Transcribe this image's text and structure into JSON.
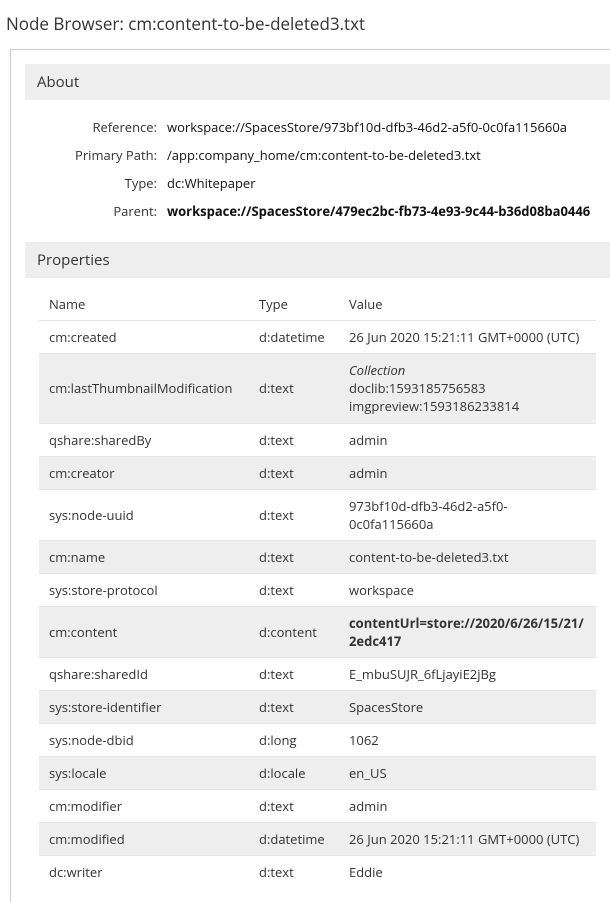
{
  "header": {
    "title": "Node Browser: cm:content-to-be-deleted3.txt"
  },
  "about": {
    "section_title": "About",
    "rows": [
      {
        "label": "Reference:",
        "value": "workspace://SpacesStore/973bf10d-dfb3-46d2-a5f0-0c0fa115660a",
        "bold": false
      },
      {
        "label": "Primary Path:",
        "value": "/app:company_home/cm:content-to-be-deleted3.txt",
        "bold": false
      },
      {
        "label": "Type:",
        "value": "dc:Whitepaper",
        "bold": false
      },
      {
        "label": "Parent:",
        "value": "workspace://SpacesStore/479ec2bc-fb73-4e93-9c44-b36d08ba0446",
        "bold": true
      }
    ]
  },
  "properties": {
    "section_title": "Properties",
    "columns": {
      "name": "Name",
      "type": "Type",
      "value": "Value"
    },
    "rows": [
      {
        "name": "cm:created",
        "type": "d:datetime",
        "value": "26 Jun 2020 15:21:11 GMT+0000 (UTC)"
      },
      {
        "name": "cm:lastThumbnailModification",
        "type": "d:text",
        "value_lines": [
          "Collection",
          "doclib:1593185756583",
          "imgpreview:1593186233814"
        ]
      },
      {
        "name": "qshare:sharedBy",
        "type": "d:text",
        "value": "admin"
      },
      {
        "name": "cm:creator",
        "type": "d:text",
        "value": "admin"
      },
      {
        "name": "sys:node-uuid",
        "type": "d:text",
        "value": "973bf10d-dfb3-46d2-a5f0-0c0fa115660a"
      },
      {
        "name": "cm:name",
        "type": "d:text",
        "value": "content-to-be-deleted3.txt"
      },
      {
        "name": "sys:store-protocol",
        "type": "d:text",
        "value": "workspace"
      },
      {
        "name": "cm:content",
        "type": "d:content",
        "value": "contentUrl=store://2020/6/26/15/21/2edc417",
        "bold": true
      },
      {
        "name": "qshare:sharedId",
        "type": "d:text",
        "value": "E_mbuSUJR_6fLjayiE2jBg"
      },
      {
        "name": "sys:store-identifier",
        "type": "d:text",
        "value": "SpacesStore"
      },
      {
        "name": "sys:node-dbid",
        "type": "d:long",
        "value": "1062"
      },
      {
        "name": "sys:locale",
        "type": "d:locale",
        "value": "en_US"
      },
      {
        "name": "cm:modifier",
        "type": "d:text",
        "value": "admin"
      },
      {
        "name": "cm:modified",
        "type": "d:datetime",
        "value": "26 Jun 2020 15:21:11 GMT+0000 (UTC)"
      },
      {
        "name": "dc:writer",
        "type": "d:text",
        "value": "Eddie"
      }
    ]
  }
}
